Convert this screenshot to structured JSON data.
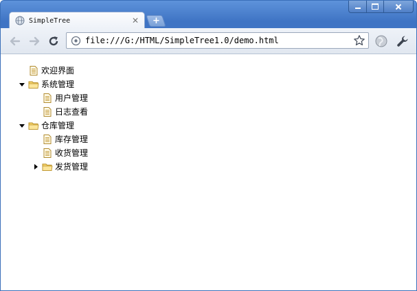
{
  "browser": {
    "tab_title": "SimpleTree",
    "new_tab_label": "+",
    "address": "file:///G:/HTML/SimpleTree1.0/demo.html"
  },
  "tree": {
    "nodes": [
      {
        "label": "欢迎界面",
        "type": "page",
        "depth": 0
      },
      {
        "label": "系统管理",
        "type": "folder",
        "depth": 0,
        "state": "expanded"
      },
      {
        "label": "用户管理",
        "type": "page",
        "depth": 1
      },
      {
        "label": "日志查看",
        "type": "page",
        "depth": 1
      },
      {
        "label": "仓库管理",
        "type": "folder",
        "depth": 0,
        "state": "expanded"
      },
      {
        "label": "库存管理",
        "type": "page",
        "depth": 1
      },
      {
        "label": "收货管理",
        "type": "page",
        "depth": 1
      },
      {
        "label": "发货管理",
        "type": "folder",
        "depth": 1,
        "state": "collapsed"
      }
    ]
  },
  "colors": {
    "titlebar": "#3f74c4",
    "folder": "#f5d26b",
    "page_lines": "#c8a24a"
  }
}
